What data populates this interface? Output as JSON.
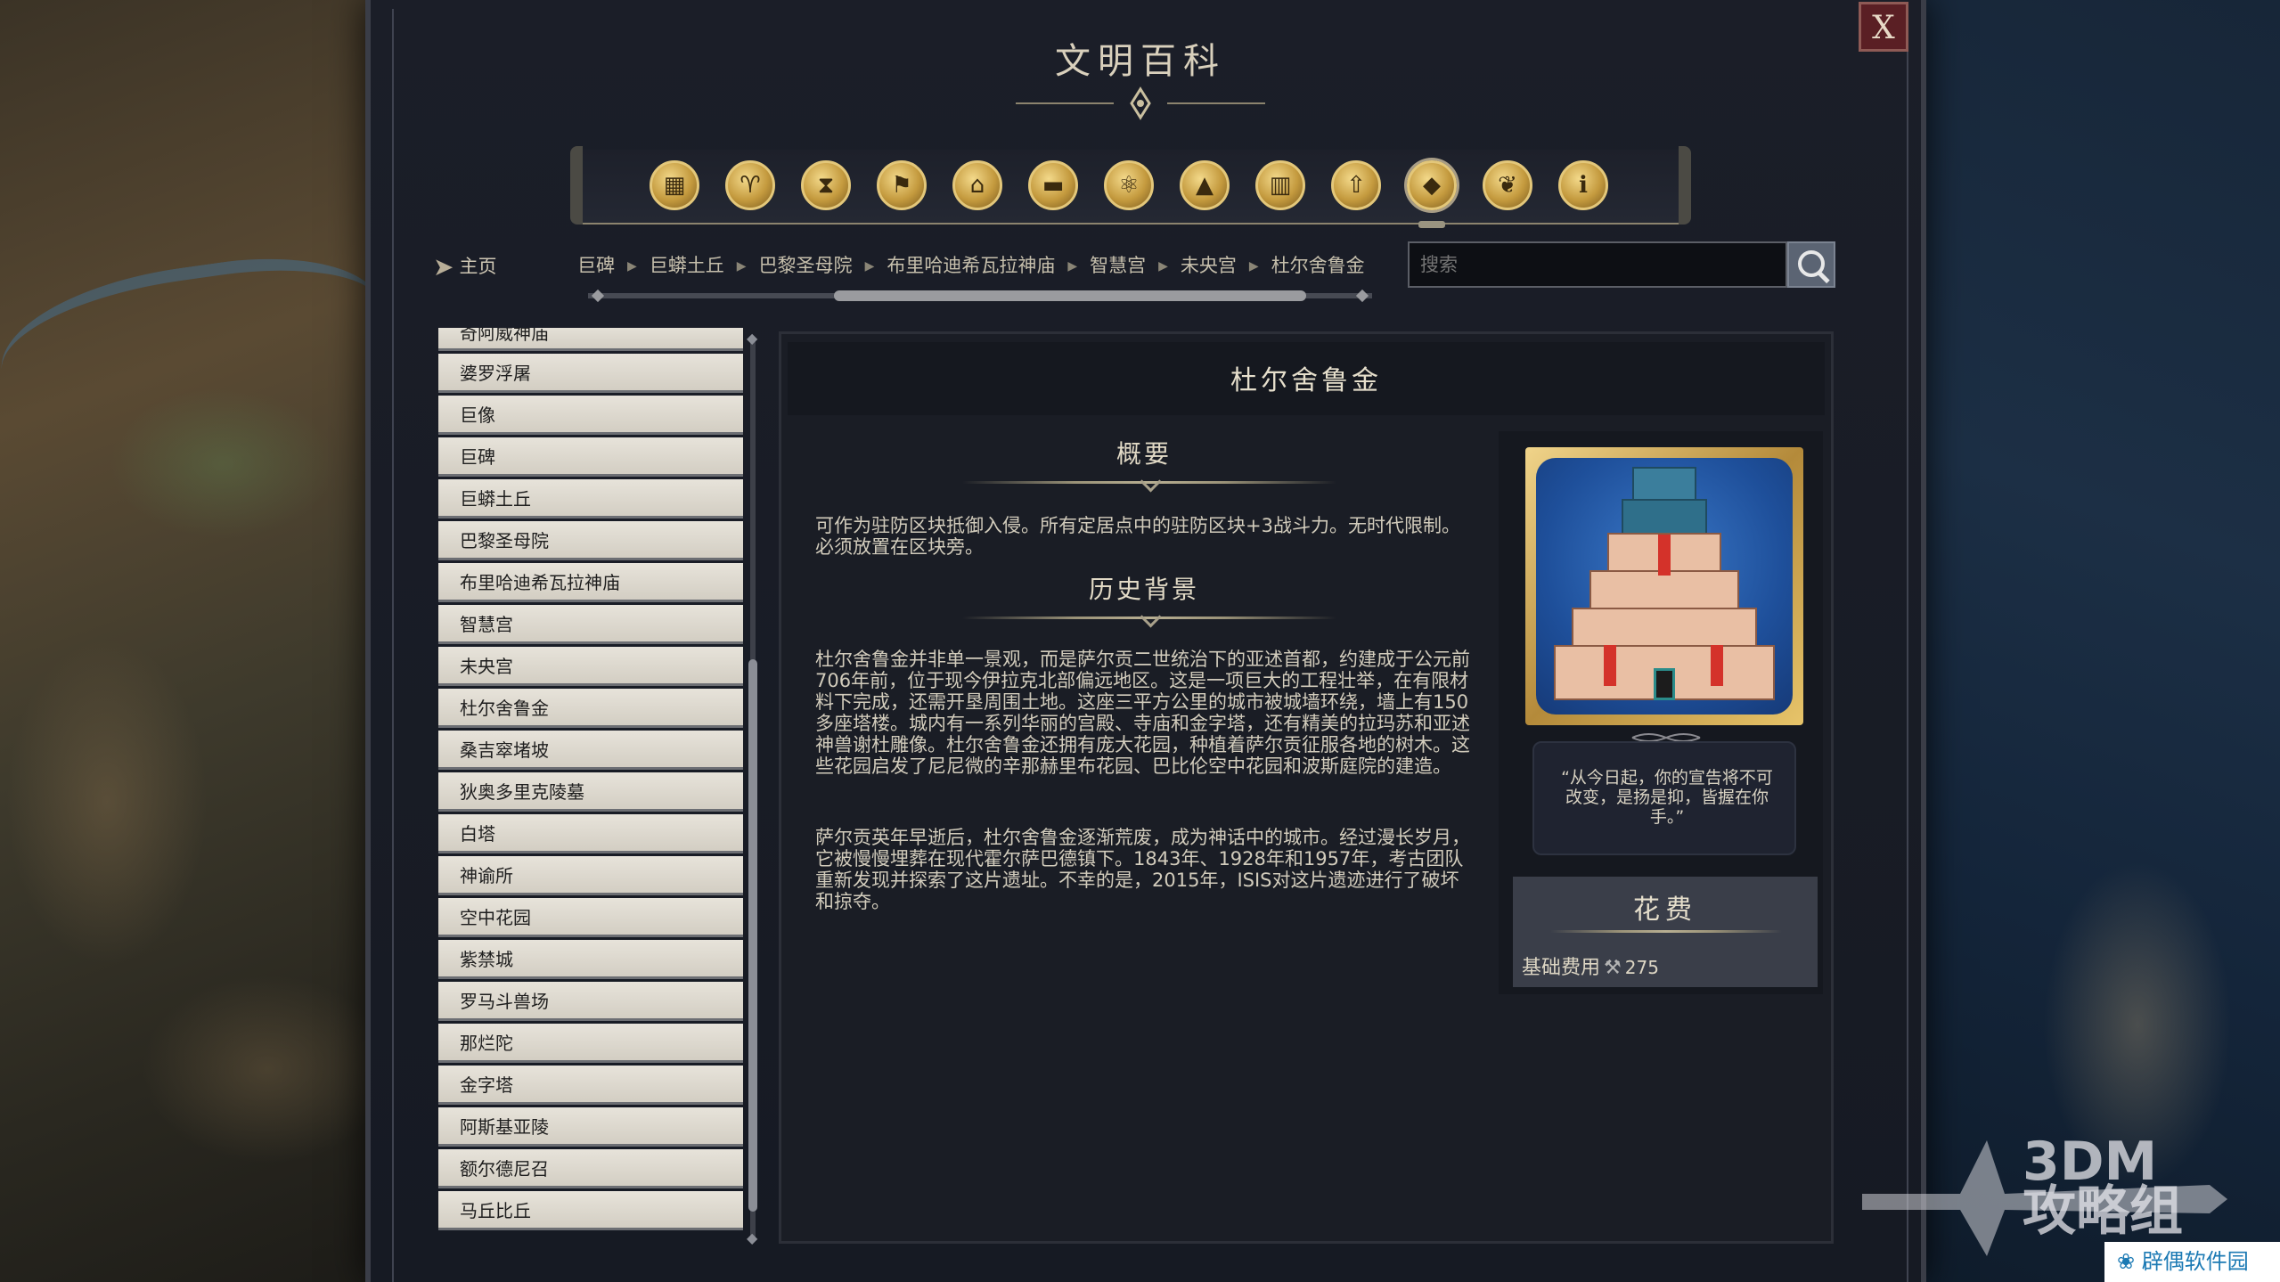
{
  "window": {
    "title": "文明百科",
    "close_label": "X"
  },
  "categories": [
    {
      "icon": "cube-stack-icon"
    },
    {
      "icon": "grail-icon"
    },
    {
      "icon": "hourglass-icon"
    },
    {
      "icon": "flag-icon"
    },
    {
      "icon": "government-building-icon"
    },
    {
      "icon": "district-icon"
    },
    {
      "icon": "atom-icon"
    },
    {
      "icon": "mountain-icon"
    },
    {
      "icon": "city-building-icon"
    },
    {
      "icon": "promotion-arrow-icon"
    },
    {
      "icon": "wonder-icon"
    },
    {
      "icon": "dove-icon"
    },
    {
      "icon": "info-icon"
    }
  ],
  "nav": {
    "home_label": "主页",
    "breadcrumb": [
      "巨碑",
      "巨蟒土丘",
      "巴黎圣母院",
      "布里哈迪希瓦拉神庙",
      "智慧宫",
      "未央宫",
      "杜尔舍鲁金"
    ],
    "search_placeholder": "搜索"
  },
  "list": {
    "items": [
      "奇阿威神庙",
      "婆罗浮屠",
      "巨像",
      "巨碑",
      "巨蟒土丘",
      "巴黎圣母院",
      "布里哈迪希瓦拉神庙",
      "智慧宫",
      "未央宫",
      "杜尔舍鲁金",
      "桑吉窣堵坡",
      "狄奥多里克陵墓",
      "白塔",
      "神谕所",
      "空中花园",
      "紫禁城",
      "罗马斗兽场",
      "那烂陀",
      "金字塔",
      "阿斯基亚陵",
      "额尔德尼召",
      "马丘比丘"
    ]
  },
  "article": {
    "title": "杜尔舍鲁金",
    "summary_heading": "概要",
    "summary": "可作为驻防区块抵御入侵。所有定居点中的驻防区块+3战斗力。无时代限制。必须放置在区块旁。",
    "history_heading": "历史背景",
    "history_p1": "杜尔舍鲁金并非单一景观，而是萨尔贡二世统治下的亚述首都，约建成于公元前706年前，位于现今伊拉克北部偏远地区。这是一项巨大的工程壮举，在有限材料下完成，还需开垦周围土地。这座三平方公里的城市被城墙环绕，墙上有150多座塔楼。城内有一系列华丽的宫殿、寺庙和金字塔，还有精美的拉玛苏和亚述神兽谢杜雕像。杜尔舍鲁金还拥有庞大花园，种植着萨尔贡征服各地的树木。这些花园启发了尼尼微的辛那赫里布花园、巴比伦空中花园和波斯庭院的建造。",
    "history_p2": "萨尔贡英年早逝后，杜尔舍鲁金逐渐荒废，成为神话中的城市。经过漫长岁月，它被慢慢埋葬在现代霍尔萨巴德镇下。1843年、1928年和1957年，考古团队重新发现并探索了这片遗址。不幸的是，2015年，ISIS对这片遗迹进行了破坏和掠夺。",
    "quote": "“从今日起，你的宣告将不可改变，是扬是抑，皆握在你手。”",
    "cost_heading": "花费",
    "cost_label": "基础费用",
    "cost_icon": "hammer-icon",
    "cost_value": "275"
  },
  "watermarks": {
    "brand_line1": "3DM",
    "brand_line2": "攻略组",
    "site": "辟偶软件园"
  }
}
